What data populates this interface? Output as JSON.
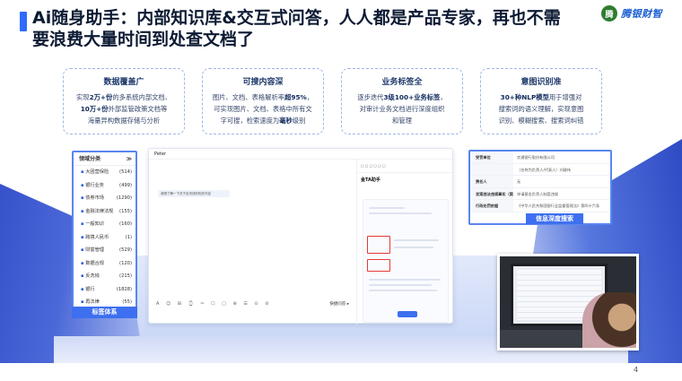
{
  "slide": {
    "title": "Ai随身助手：内部知识库&交互式问答，人人都是产品专家，再也不需要浪费大量时间到处查文档了",
    "page_number": "4",
    "logo": {
      "mark": "腾",
      "text": "腾银财智"
    }
  },
  "cards": [
    {
      "title": "数据覆盖广",
      "line1_a": "实现",
      "line1_b": "2万+份",
      "line1_c": "的多系统内部文档、",
      "line2_a": "",
      "line2_b": "10万+份",
      "line2_c": "外部监管政策文档等",
      "line3": "海量异构数据存储与分析"
    },
    {
      "title": "可搜内容深",
      "line1_a": "图片、文档、表格解析率",
      "line1_b": "超95%",
      "line1_c": "，",
      "line2_a": "可实现图片、文档、表格中所有文",
      "line2_b": "",
      "line2_c": "",
      "line3_a": "字可搜，检索速度为",
      "line3_b": "毫秒",
      "line3_c": "级别"
    },
    {
      "title": "业务标签全",
      "line1_a": "逐步迭代",
      "line1_b": "3级100+业务标签",
      "line1_c": "，",
      "line2": "对审计业务文档进行深度组织",
      "line3": "和管理"
    },
    {
      "title": "意图识别准",
      "line1_b": "30+种NLP模型",
      "line1_c": "用于增强对",
      "line2": "搜索词的语义理解，实现意图",
      "line3": "识别、模糊搜索、搜索词纠错"
    }
  ],
  "left_panel": {
    "header": "领域分类",
    "items": [
      {
        "label": "大团营保险",
        "count": "(514)"
      },
      {
        "label": "银行业务",
        "count": "(499)"
      },
      {
        "label": "债券市场",
        "count": "(1290)"
      },
      {
        "label": "金融法律法规",
        "count": "(155)"
      },
      {
        "label": "一般知识",
        "count": "(160)"
      },
      {
        "label": "跨境人民币",
        "count": "(1)"
      },
      {
        "label": "财富管理",
        "count": "(529)"
      },
      {
        "label": "数据合规",
        "count": "(120)"
      },
      {
        "label": "反洗钱",
        "count": "(215)"
      },
      {
        "label": "银行",
        "count": "(1828)"
      },
      {
        "label": "再法律",
        "count": "(55)"
      },
      {
        "label": "证券基金监管",
        "count": "(1228)"
      }
    ],
    "label": "标签体系"
  },
  "app": {
    "user": "Peter",
    "bubble_text": "我想了解一下关于反洗钱的相关内容",
    "assistant_title": "金TA助手",
    "toolbar": "A ☺ ⊞ ⌚ ✂ ☐ ▢ ⊕ ☰ ⊙ ⊘",
    "send_label": "快捷问答 ▸"
  },
  "right_panel": {
    "rows": [
      {
        "key": "受罚单位",
        "value": "交通银行股份有限公司"
      },
      {
        "key": "",
        "value": "（名称为负责人/代表人）刘建伟"
      },
      {
        "key": "责任人",
        "value": "无"
      },
      {
        "key": "发案违法违规事实（案由）",
        "value": "申请基金负责人制度违规"
      },
      {
        "key": "行政处罚依据",
        "value": "《中华人民共和国银行业监督管理法》第四十六条"
      }
    ],
    "label": "信息深度搜索"
  }
}
